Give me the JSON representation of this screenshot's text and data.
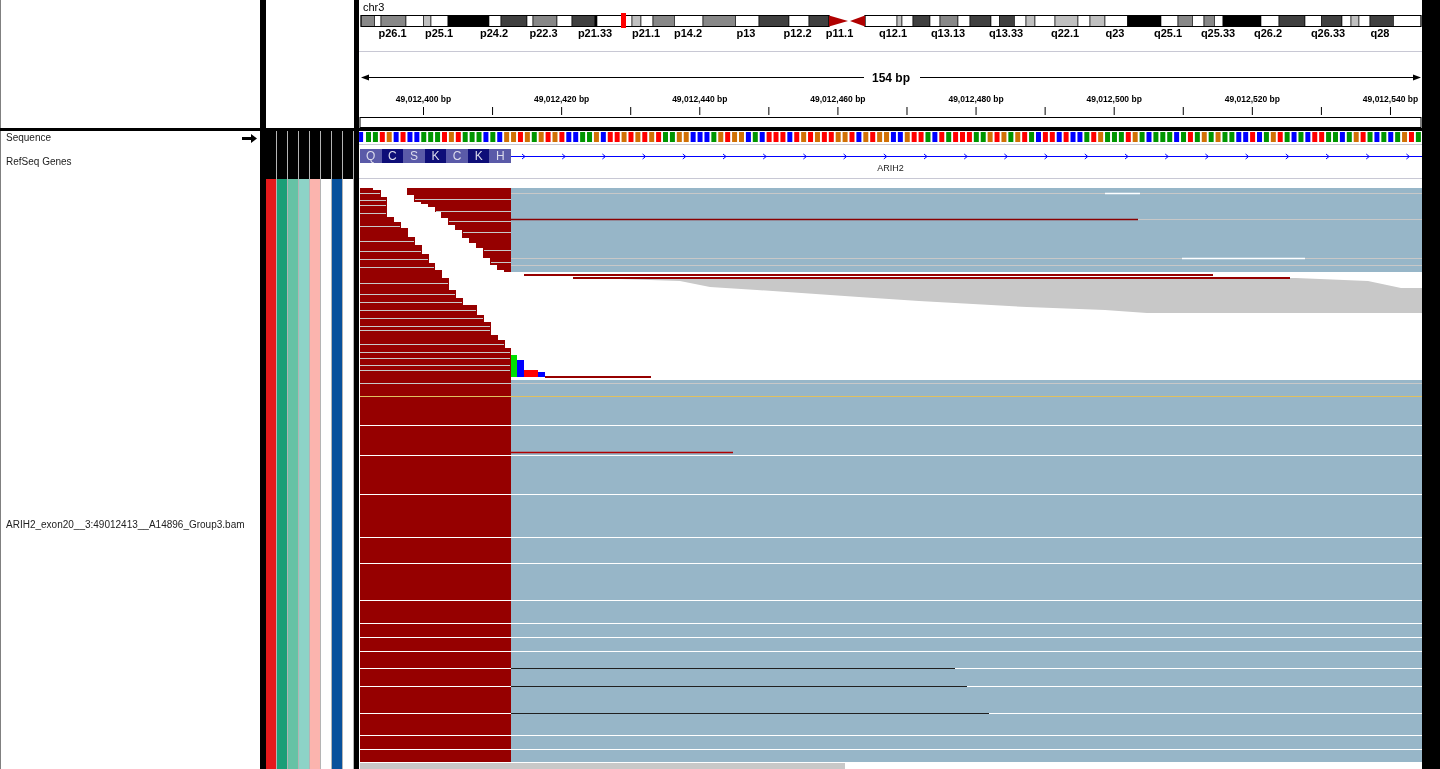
{
  "header": {
    "chromosome": "chr3",
    "band_labels": [
      "p26.1",
      "p25.1",
      "p24.2",
      "p22.3",
      "p21.33",
      "p21.1",
      "p14.2",
      "p13",
      "p12.2",
      "p11.1",
      "q12.1",
      "q13.13",
      "q13.33",
      "q22.1",
      "q23",
      "q25.1",
      "q25.33",
      "q26.2",
      "q26.33",
      "q28"
    ],
    "ruler": {
      "span": "154 bp",
      "tick_labels": [
        "49,012,400 bp",
        "49,012,420 bp",
        "49,012,440 bp",
        "49,012,460 bp",
        "49,012,480 bp",
        "49,012,500 bp",
        "49,012,520 bp",
        "49,012,540 bp"
      ]
    }
  },
  "tracks": [
    {
      "kind": "sequence",
      "name": "Sequence",
      "forward_strand": true,
      "bases": [
        {
          "color": "#0000ff"
        },
        {
          "color": "#009600"
        },
        {
          "color": "#009600"
        },
        {
          "color": "#ff0000"
        },
        {
          "color": "#d17105"
        },
        {
          "color": "#0000ff"
        },
        {
          "color": "#ff0000"
        },
        {
          "color": "#0000ff"
        },
        {
          "color": "#0000ff"
        },
        {
          "color": "#009600"
        },
        {
          "color": "#009600"
        },
        {
          "color": "#009600"
        },
        {
          "color": "#ff0000"
        },
        {
          "color": "#d17105"
        },
        {
          "color": "#ff0000"
        },
        {
          "color": "#009600"
        },
        {
          "color": "#009600"
        },
        {
          "color": "#009600"
        },
        {
          "color": "#0000ff"
        },
        {
          "color": "#009600"
        },
        {
          "color": "#0000ff"
        },
        {
          "color": "#d17105"
        },
        {
          "color": "#d17105"
        },
        {
          "color": "#ff0000"
        },
        {
          "color": "#d17105"
        },
        {
          "color": "#009600"
        },
        {
          "color": "#d17105"
        },
        {
          "color": "#ff0000"
        },
        {
          "color": "#d17105"
        },
        {
          "color": "#ff0000"
        },
        {
          "color": "#0000ff"
        },
        {
          "color": "#0000ff"
        },
        {
          "color": "#009600"
        },
        {
          "color": "#009600"
        },
        {
          "color": "#d17105"
        },
        {
          "color": "#0000ff"
        },
        {
          "color": "#ff0000"
        },
        {
          "color": "#ff0000"
        },
        {
          "color": "#d17105"
        },
        {
          "color": "#ff0000"
        },
        {
          "color": "#d17105"
        },
        {
          "color": "#ff0000"
        },
        {
          "color": "#d17105"
        },
        {
          "color": "#ff0000"
        },
        {
          "color": "#009600"
        },
        {
          "color": "#009600"
        },
        {
          "color": "#d17105"
        },
        {
          "color": "#d17105"
        },
        {
          "color": "#0000ff"
        },
        {
          "color": "#0000ff"
        },
        {
          "color": "#0000ff"
        },
        {
          "color": "#009600"
        },
        {
          "color": "#d17105"
        },
        {
          "color": "#ff0000"
        },
        {
          "color": "#d17105"
        },
        {
          "color": "#d17105"
        },
        {
          "color": "#0000ff"
        },
        {
          "color": "#009600"
        },
        {
          "color": "#0000ff"
        },
        {
          "color": "#ff0000"
        },
        {
          "color": "#ff0000"
        },
        {
          "color": "#ff0000"
        },
        {
          "color": "#0000ff"
        },
        {
          "color": "#ff0000"
        },
        {
          "color": "#d17105"
        },
        {
          "color": "#ff0000"
        },
        {
          "color": "#d17105"
        },
        {
          "color": "#ff0000"
        },
        {
          "color": "#ff0000"
        },
        {
          "color": "#d17105"
        },
        {
          "color": "#d17105"
        },
        {
          "color": "#ff0000"
        },
        {
          "color": "#0000ff"
        },
        {
          "color": "#d17105"
        },
        {
          "color": "#ff0000"
        },
        {
          "color": "#d17105"
        },
        {
          "color": "#d17105"
        },
        {
          "color": "#0000ff"
        },
        {
          "color": "#0000ff"
        },
        {
          "color": "#d17105"
        },
        {
          "color": "#ff0000"
        },
        {
          "color": "#ff0000"
        },
        {
          "color": "#009600"
        },
        {
          "color": "#0000ff"
        },
        {
          "color": "#ff0000"
        },
        {
          "color": "#009600"
        },
        {
          "color": "#ff0000"
        },
        {
          "color": "#ff0000"
        },
        {
          "color": "#ff0000"
        },
        {
          "color": "#009600"
        },
        {
          "color": "#009600"
        },
        {
          "color": "#d17105"
        },
        {
          "color": "#ff0000"
        },
        {
          "color": "#d17105"
        },
        {
          "color": "#009600"
        },
        {
          "color": "#d17105"
        },
        {
          "color": "#ff0000"
        },
        {
          "color": "#009600"
        },
        {
          "color": "#0000ff"
        },
        {
          "color": "#ff0000"
        },
        {
          "color": "#ff0000"
        },
        {
          "color": "#0000ff"
        },
        {
          "color": "#ff0000"
        },
        {
          "color": "#0000ff"
        },
        {
          "color": "#0000ff"
        },
        {
          "color": "#009600"
        },
        {
          "color": "#ff0000"
        },
        {
          "color": "#d17105"
        },
        {
          "color": "#009600"
        },
        {
          "color": "#009600"
        },
        {
          "color": "#009600"
        },
        {
          "color": "#ff0000"
        },
        {
          "color": "#d17105"
        },
        {
          "color": "#009600"
        },
        {
          "color": "#0000ff"
        },
        {
          "color": "#009600"
        },
        {
          "color": "#009600"
        },
        {
          "color": "#009600"
        },
        {
          "color": "#0000ff"
        },
        {
          "color": "#009600"
        },
        {
          "color": "#ff0000"
        },
        {
          "color": "#009600"
        },
        {
          "color": "#d17105"
        },
        {
          "color": "#009600"
        },
        {
          "color": "#d17105"
        },
        {
          "color": "#009600"
        },
        {
          "color": "#009600"
        },
        {
          "color": "#0000ff"
        },
        {
          "color": "#0000ff"
        },
        {
          "color": "#ff0000"
        },
        {
          "color": "#0000ff"
        },
        {
          "color": "#009600"
        },
        {
          "color": "#d17105"
        },
        {
          "color": "#ff0000"
        },
        {
          "color": "#009600"
        },
        {
          "color": "#0000ff"
        },
        {
          "color": "#009600"
        },
        {
          "color": "#0000ff"
        },
        {
          "color": "#ff0000"
        },
        {
          "color": "#ff0000"
        },
        {
          "color": "#009600"
        },
        {
          "color": "#009600"
        },
        {
          "color": "#0000ff"
        },
        {
          "color": "#009600"
        },
        {
          "color": "#d17105"
        },
        {
          "color": "#ff0000"
        },
        {
          "color": "#009600"
        },
        {
          "color": "#0000ff"
        },
        {
          "color": "#009600"
        },
        {
          "color": "#0000ff"
        },
        {
          "color": "#009600"
        },
        {
          "color": "#d17105"
        },
        {
          "color": "#ff0000"
        },
        {
          "color": "#009600"
        }
      ]
    },
    {
      "kind": "gene",
      "name": "RefSeq Genes",
      "amino_acids": [
        "Q",
        "C",
        "S",
        "K",
        "C",
        "K",
        "H"
      ],
      "gene": "ARIH2"
    },
    {
      "kind": "alignment",
      "name": "ARIH2_exon20__3:49012413__A14896_Group3.bam",
      "attributes": [
        {
          "color": "#e41a1c"
        },
        {
          "color": "#1b9e77"
        },
        {
          "color": "#66c2a5"
        },
        {
          "color": "#8dd3c7"
        },
        {
          "color": "#fbb4ae"
        },
        {
          "color": "#ffffff"
        },
        {
          "color": "#08519c"
        },
        {
          "color": "#ffffff"
        }
      ]
    }
  ]
}
